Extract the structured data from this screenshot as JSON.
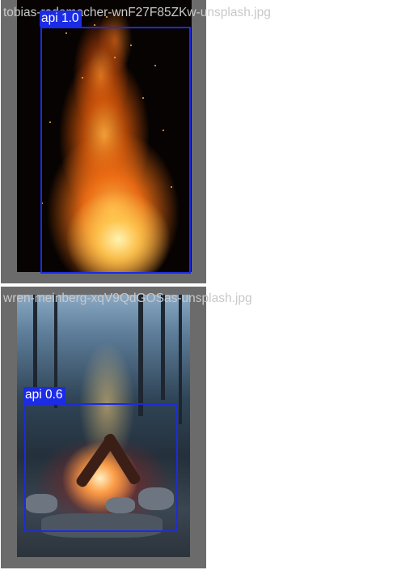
{
  "results": [
    {
      "filename": "tobias-rademacher-wnF27F85ZKw-unsplash.jpg",
      "detection": {
        "label": "api",
        "score": "1.0"
      }
    },
    {
      "filename": "wren-meinberg-xqV9QdGOSas-unsplash.jpg",
      "detection": {
        "label": "api",
        "score": "0.6"
      }
    }
  ],
  "badges": [
    "api 1.0",
    "api 0.6"
  ],
  "colors": {
    "box": "#1b2be6",
    "tile_background": "#6b6b6b",
    "filename_text": "#c9c9c9"
  }
}
